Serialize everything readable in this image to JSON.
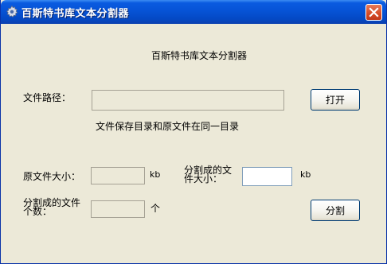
{
  "window": {
    "title": "百斯特书库文本分割器",
    "close_icon": "close-icon",
    "app_icon": "gear-icon"
  },
  "heading": "百斯特书库文本分割器",
  "file_path": {
    "label": "文件路径：",
    "value": "",
    "open_button": "打开"
  },
  "note": "文件保存目录和原文件在同一目录",
  "original_size": {
    "label": "原文件大小：",
    "value": "",
    "unit": "kb"
  },
  "split_size": {
    "label_line1": "分割成的文",
    "label_line2": "件大小：",
    "value": "",
    "unit": "kb"
  },
  "split_count": {
    "label_line1": "分割成的文件",
    "label_line2": "个数：",
    "value": "",
    "unit": "个"
  },
  "split_button": "分割",
  "colors": {
    "titlebar": "#0653d6",
    "face": "#ece9d8",
    "close": "#d54a25"
  }
}
